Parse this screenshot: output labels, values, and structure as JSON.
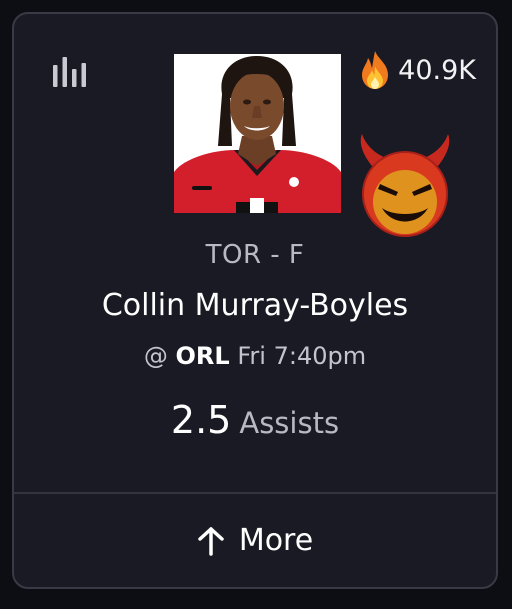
{
  "card": {
    "popularity_count": "40.9K",
    "player": {
      "team_position": "TOR - F",
      "name": "Collin Murray-Boyles"
    },
    "matchup": {
      "at_symbol": "@",
      "opponent": "ORL",
      "game_time": "Fri 7:40pm"
    },
    "projection": {
      "line": "2.5",
      "stat": "Assists"
    },
    "more_button": {
      "label": "More"
    }
  },
  "icons": {
    "stats": "bar-chart-icon",
    "popularity": "flame-icon",
    "modifier": "demon-icon",
    "more": "arrow-up-icon"
  },
  "colors": {
    "background": "#0d0d14",
    "card_background": "#1a1a24",
    "card_border": "#3a3a46",
    "jersey_red": "#d21f2b",
    "demon_red": "#c8291f"
  }
}
